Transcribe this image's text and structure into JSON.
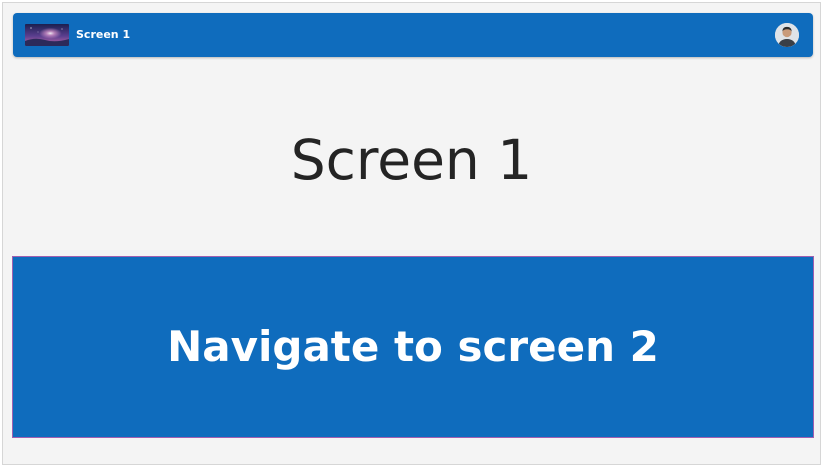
{
  "header": {
    "title": "Screen 1",
    "background_color": "#0f6cbd",
    "logo_icon": "galaxy-image",
    "avatar_icon": "user-avatar"
  },
  "main": {
    "heading": "Screen 1",
    "navigate_button_label": "Navigate to screen 2",
    "button_color": "#0f6cbd"
  }
}
